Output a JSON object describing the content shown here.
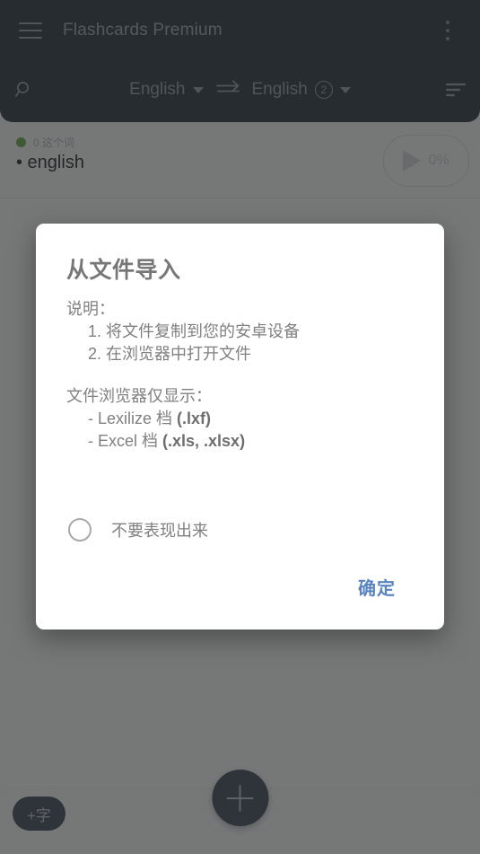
{
  "appbar": {
    "menu_icon": "hamburger-menu-icon",
    "title": "Flashcards Premium",
    "overflow_icon": "kebab-menu-icon",
    "search_icon": "search-icon",
    "sort_icon": "sort-icon",
    "swap_icon": "swap-arrows-icon",
    "lang_from": "English",
    "lang_to": "English",
    "lang_to_badge": "2"
  },
  "list": {
    "group_count": "0 这个词",
    "group_title": "• english",
    "play_percent": "0%",
    "play_icon": "play-icon",
    "status_dot_color": "#62a346"
  },
  "bottombar": {
    "add_char_label": "+字",
    "fab_icon": "plus-icon"
  },
  "dialog": {
    "title": "从文件导入",
    "instructions_heading": "说明：",
    "steps": [
      "1. 将文件复制到您的安卓设备",
      "2. 在浏览器中打开文件"
    ],
    "browser_heading": "文件浏览器仅显示：",
    "file_types": [
      {
        "prefix": "- Lexilize 档 ",
        "bold": "(.lxf)"
      },
      {
        "prefix": "- Excel 档 ",
        "bold": "(.xls, .xlsx)"
      }
    ],
    "dont_show_label": "不要表现出来",
    "dont_show_checked": false,
    "ok_label": "确定",
    "ok_color": "#5a84c0"
  },
  "colors": {
    "appbar_bg": "#26323e",
    "scrim": "rgba(40,40,40,0.60)",
    "dialog_bg": "#ffffff",
    "text_muted": "#808080"
  }
}
